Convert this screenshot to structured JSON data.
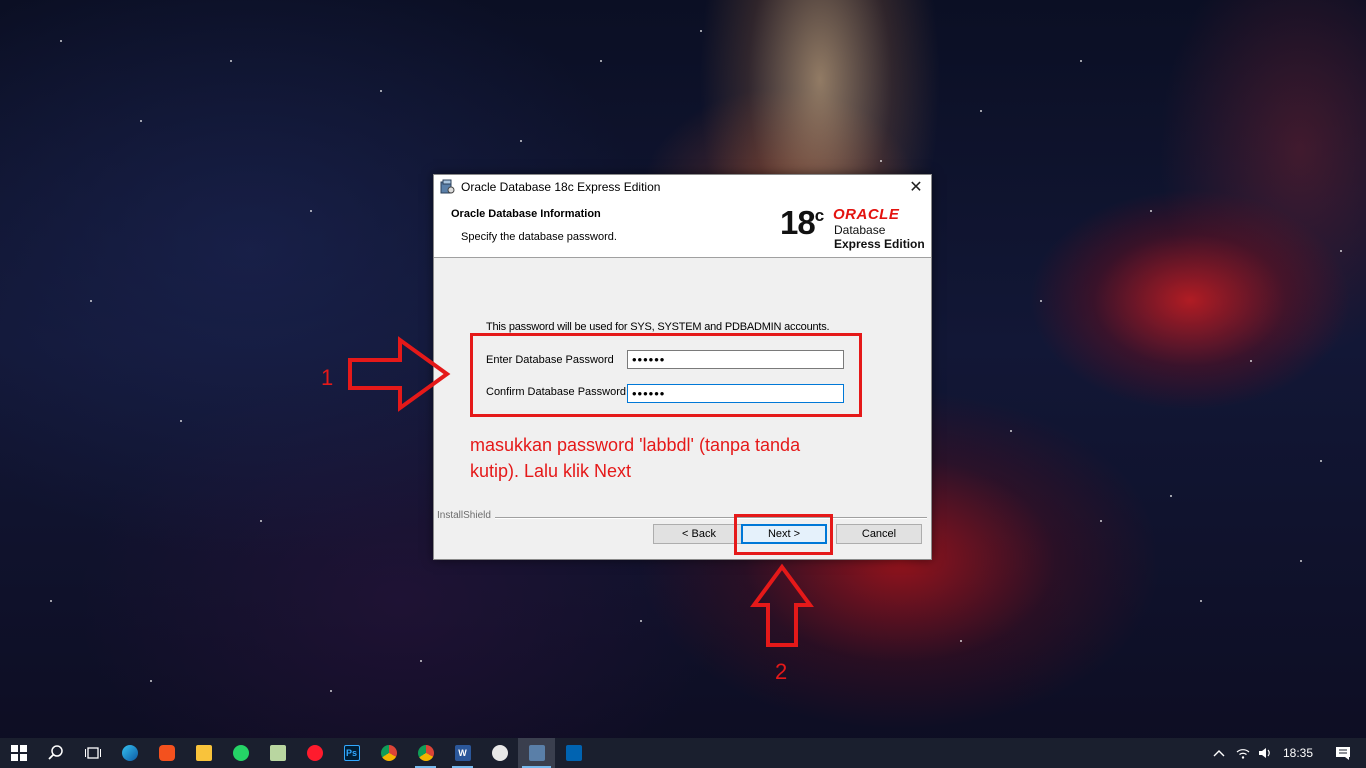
{
  "window": {
    "title": "Oracle Database 18c Express Edition"
  },
  "banner": {
    "heading": "Oracle Database Information",
    "subheading": "Specify the database password.",
    "logo_version": "18",
    "logo_version_suffix": "c",
    "logo_brand": "ORACLE",
    "logo_line1": "Database",
    "logo_line2": "Express Edition"
  },
  "form": {
    "info": "This password will be used for SYS, SYSTEM and PDBADMIN accounts.",
    "password_label": "Enter Database Password",
    "password_value": "••••••",
    "confirm_label": "Confirm Database Password",
    "confirm_value": "••••••"
  },
  "footer": {
    "brand": "InstallShield",
    "back_label": "< Back",
    "next_label": "Next >",
    "cancel_label": "Cancel"
  },
  "annotations": {
    "step1": "1",
    "step2": "2",
    "instruction": "masukkan password 'labbdl' (tanpa tanda kutip). Lalu klik Next",
    "color": "#e51919"
  },
  "taskbar": {
    "items": [
      "start-icon",
      "search-icon",
      "task-view-icon",
      "edge-icon",
      "app-icon",
      "file-explorer-icon",
      "whatsapp-icon",
      "notepad-icon",
      "opera-icon",
      "photoshop-icon",
      "chrome-icon",
      "chrome-icon",
      "word-icon",
      "paint-icon",
      "installer-icon",
      "photos-icon"
    ],
    "time": "18:35"
  }
}
